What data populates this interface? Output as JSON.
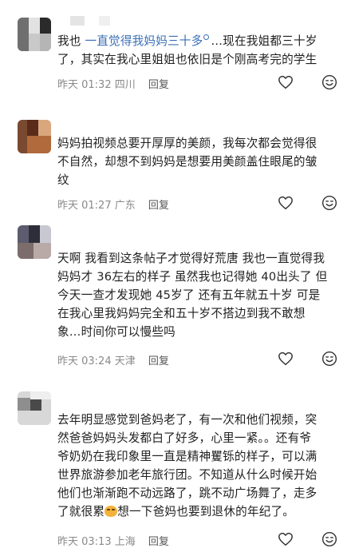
{
  "comments": [
    {
      "text_lines": [
        [
          "我也 ",
          "一直觉得我妈妈三十多",
          "…现在我姐都三十岁"
        ],
        "了，其实在我心里姐姐也依旧是个刚高考完的学生"
      ],
      "time": "昨天 01:32",
      "location": "四川",
      "reply": "回复",
      "like_icon": "heart-icon",
      "react_icon": "emoji-face-icon"
    },
    {
      "text_lines": [
        "妈妈拍视频总要开厚厚的美颜，我每次都会觉得很",
        "不自然，却想不到妈妈是想要用美颜盖住眼尾的皱",
        "纹"
      ],
      "time": "昨天 01:27",
      "location": "广东",
      "reply": "回复",
      "like_icon": "heart-icon",
      "react_icon": "emoji-face-icon"
    },
    {
      "text_lines": [
        "天啊 我看到这条帖子才觉得好荒唐 我也一直觉得我",
        "妈妈才 36左右的样子 虽然我也记得她 40出头了 但",
        "今天一查才发现她 45岁了 还有五年就五十岁 可是",
        "在我心里我妈妈完全和五十岁不搭边到我不敢想",
        "象…时间你可以慢些吗"
      ],
      "time": "昨天 03:24",
      "location": "天津",
      "reply": "回复",
      "like_icon": "heart-icon",
      "react_icon": "emoji-face-icon"
    },
    {
      "text_lines": [
        "去年明显感觉到爸妈老了，有一次和他们视频，突",
        "然爸爸妈妈头发都白了好多，心里一紧。。还有爷",
        "爷奶奶在我印象里一直是精神矍铄的样子，可以满",
        "世界旅游参加老年旅行团。不知道从什么时候开始",
        "他们也渐渐跑不动远路了，跳不动广场舞了，走多",
        [
          "了就很累",
          "想一下爸妈也要到退休的年纪了。"
        ]
      ],
      "time": "昨天 03:13",
      "location": "上海",
      "reply": "回复",
      "like_icon": "heart-icon",
      "react_icon": "emoji-face-icon",
      "inline_emoji": "tired-face-emoji"
    }
  ],
  "colors": {
    "link": "#3b6fb6",
    "meta": "#8a8a8a",
    "text": "#1f1f1f"
  }
}
